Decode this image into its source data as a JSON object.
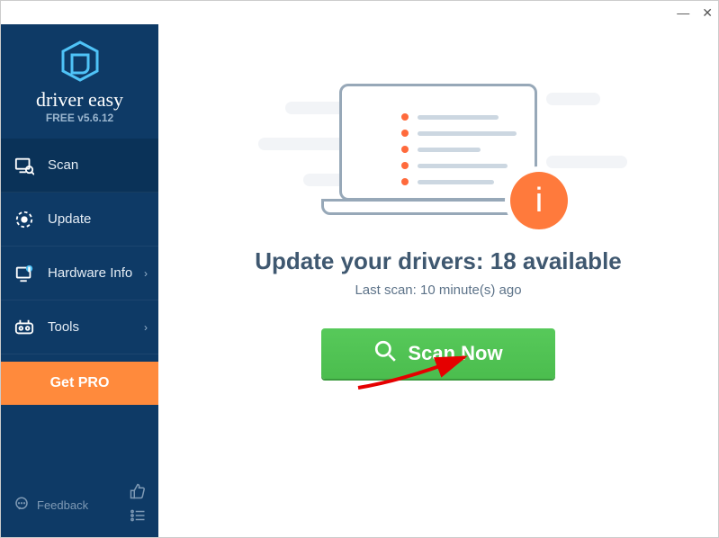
{
  "app": {
    "brand": "driver easy",
    "version": "FREE v5.6.12"
  },
  "sidebar": {
    "items": [
      {
        "label": "Scan"
      },
      {
        "label": "Update"
      },
      {
        "label": "Hardware Info"
      },
      {
        "label": "Tools"
      }
    ],
    "get_pro": "Get PRO",
    "feedback": "Feedback"
  },
  "main": {
    "headline_prefix": "Update your drivers: ",
    "available_count": "18",
    "headline_suffix": " available",
    "last_scan": "Last scan: 10 minute(s) ago",
    "scan_button": "Scan Now"
  },
  "titlebar": {
    "minimize": "—",
    "close": "✕"
  }
}
